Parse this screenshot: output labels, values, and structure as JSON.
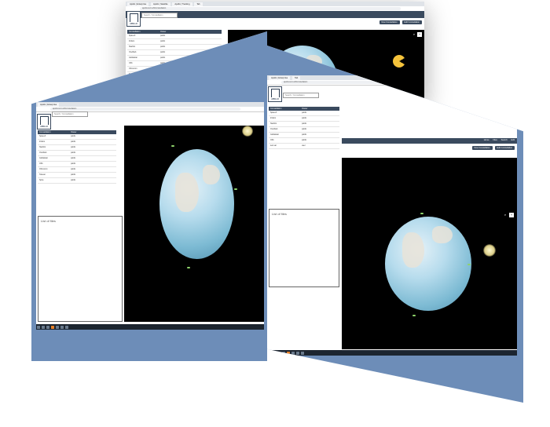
{
  "browser": {
    "tabs": [
      "Apollo | Enterprise",
      "Apollo | Satellite",
      "Apollo | Tracking",
      "Tab"
    ],
    "url": "apollo-isd.ru/#/constellation"
  },
  "app": {
    "logo_text": "APOLLO",
    "search_placeholder": "Search / Constellation",
    "nav": [
      "Home",
      "Files",
      "Search",
      "Edit"
    ],
    "buttons": {
      "new": "New Constellation",
      "edit": "Edit Constellation"
    }
  },
  "table": {
    "headers": [
      "Constellation",
      "Owner"
    ],
    "rows": [
      [
        "SpaceX",
        "public"
      ],
      [
        "Iridium",
        "public"
      ],
      [
        "Starlink",
        "public"
      ],
      [
        "OneWeb",
        "public"
      ],
      [
        "Globalstar",
        "public"
      ],
      [
        "O3b",
        "public"
      ],
      [
        "Orbcomm",
        "public"
      ],
      [
        "Telesat",
        "public"
      ],
      [
        "Spire",
        "public"
      ],
      [
        "test sat",
        "user"
      ]
    ]
  },
  "files_panel": {
    "label": "List of files"
  },
  "viewer": {
    "zoom_in": "+",
    "zoom_out": "-"
  },
  "colors": {
    "appbar": "#3a4a5e",
    "frame": "#6d8db8",
    "space": "#000000",
    "accent": "#e8822a"
  }
}
